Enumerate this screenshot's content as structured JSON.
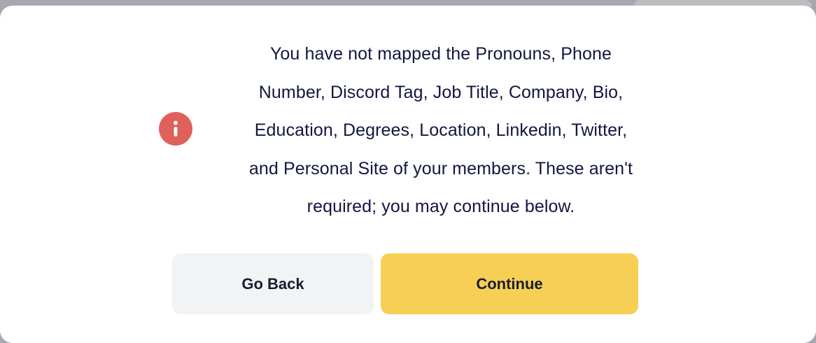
{
  "dialog": {
    "message_lines": [
      "You have not mapped the Pronouns, Phone",
      "Number, Discord Tag, Job Title, Company, Bio,",
      "Education, Degrees, Location, Linkedin, Twitter,",
      "and Personal Site of your members. These aren't",
      "required; you may continue below."
    ],
    "icon": "info-icon",
    "icon_color": "#e0605a"
  },
  "buttons": {
    "back_label": "Go Back",
    "continue_label": "Continue"
  },
  "colors": {
    "accent": "#f6cf54",
    "secondary_button": "#f2f3f5",
    "text": "#13173f",
    "backdrop": "#a6a8ae"
  }
}
